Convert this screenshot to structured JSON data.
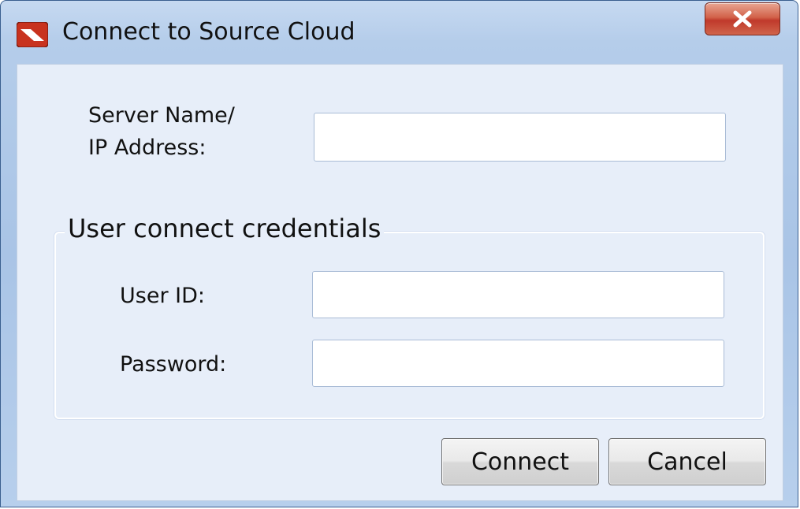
{
  "window": {
    "title": "Connect to Source Cloud",
    "close_glyph": "x",
    "icon": "source-cloud-app-icon"
  },
  "form": {
    "server_label_line1": "Server Name/",
    "server_label_line2": "IP Address:",
    "server_value": "",
    "group_title": "User connect credentials",
    "user_id_label": "User ID:",
    "user_id_value": "",
    "password_label": "Password:",
    "password_value": ""
  },
  "buttons": {
    "connect_label": "Connect",
    "cancel_label": "Cancel"
  },
  "colors": {
    "titlebar": "#b5cdea",
    "client_background": "#e7eef9",
    "close_button": "#c0392b"
  }
}
